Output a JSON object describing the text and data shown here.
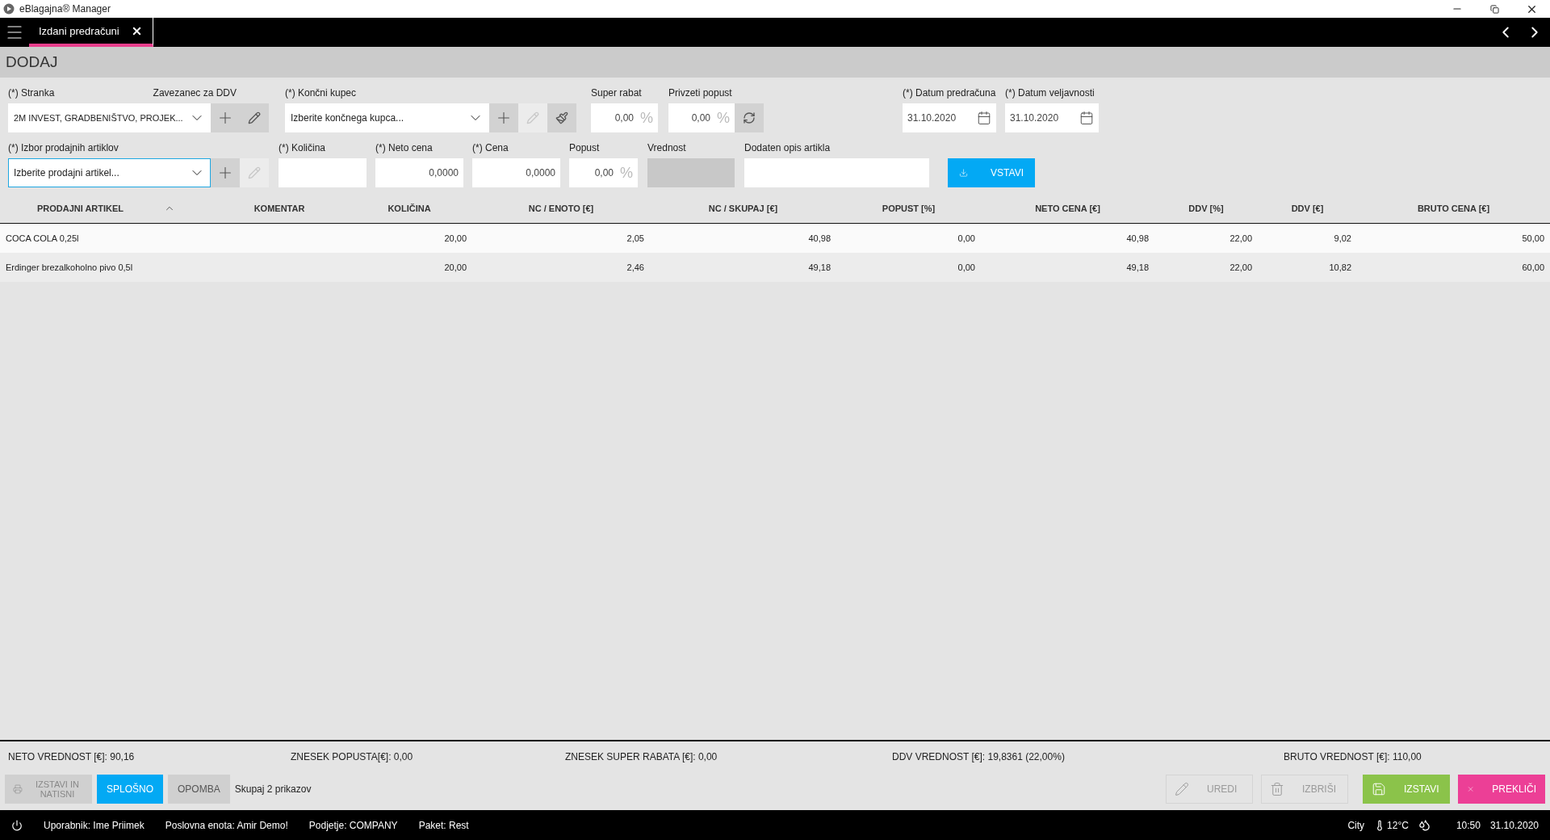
{
  "window": {
    "title": "eBlagajna® Manager"
  },
  "tabs": [
    {
      "label": "Izdani predračuni",
      "selected": true
    }
  ],
  "header": {
    "title": "DODAJ"
  },
  "row1": {
    "stranka": {
      "label": "(*) Stranka",
      "value": "2M INVEST, GRADBENIŠTVO, PROJEK..."
    },
    "zavezanec_label": "Zavezanec za DDV",
    "kupec": {
      "label": "(*) Končni kupec",
      "placeholder": "Izberite končnega kupca..."
    },
    "super_rabat": {
      "label": "Super rabat",
      "value": "0,00",
      "unit": "%"
    },
    "privzeti_popust": {
      "label": "Privzeti popust",
      "value": "0,00",
      "unit": "%"
    },
    "datum_predracuna": {
      "label": "(*) Datum predračuna",
      "value": "31.10.2020"
    },
    "datum_veljavnosti": {
      "label": "(*) Datum veljavnosti",
      "value": "31.10.2020"
    }
  },
  "row2": {
    "artikel": {
      "label": "(*) Izbor prodajnih artiklov",
      "placeholder": "Izberite prodajni artikel..."
    },
    "kolicina": {
      "label": "(*) Količina"
    },
    "neto_cena": {
      "label": "(*) Neto cena",
      "value": "0,0000"
    },
    "cena": {
      "label": "(*) Cena",
      "value": "0,0000"
    },
    "popust": {
      "label": "Popust",
      "value": "0,00",
      "unit": "%"
    },
    "vrednost": {
      "label": "Vrednost"
    },
    "opis": {
      "label": "Dodaten opis artikla"
    },
    "insert_button": "VSTAVI"
  },
  "table": {
    "columns": [
      "PRODAJNI ARTIKEL",
      "KOMENTAR",
      "KOLIČINA",
      "NC / ENOTO [€]",
      "NC / SKUPAJ [€]",
      "POPUST [%]",
      "NETO CENA [€]",
      "DDV [%]",
      "DDV [€]",
      "BRUTO CENA [€]"
    ],
    "rows": [
      {
        "selected": true,
        "cells": [
          "COCA COLA 0,25l",
          "",
          "20,00",
          "2,05",
          "40,98",
          "0,00",
          "40,98",
          "22,00",
          "9,02",
          "50,00"
        ]
      },
      {
        "selected": false,
        "cells": [
          "Erdinger brezalkoholno pivo 0,5l",
          "",
          "20,00",
          "2,46",
          "49,18",
          "0,00",
          "49,18",
          "22,00",
          "10,82",
          "60,00"
        ]
      }
    ]
  },
  "summary": [
    "NETO VREDNOST [€]: 90,16",
    "ZNESEK POPUSTA[€]: 0,00",
    "ZNESEK SUPER RABATA [€]: 0,00",
    "DDV VREDNOST [€]: 19,8361 (22,00%)",
    "BRUTO VREDNOST [€]: 110,00"
  ],
  "print_button": {
    "label": "IZSTAVI IN NATISNI",
    "disabled": true
  },
  "bottom_tabs": [
    {
      "label": "SPLOŠNO",
      "selected": true
    },
    {
      "label": "OPOMBA",
      "selected": false
    }
  ],
  "count": "Skupaj 2 prikazov",
  "actions": [
    {
      "kind": "edit",
      "label": "UREDI",
      "disabled": true
    },
    {
      "kind": "delete",
      "label": "IZBRIŠI",
      "disabled": true
    },
    {
      "kind": "issue",
      "label": "IZSTAVI",
      "disabled": false
    },
    {
      "kind": "cancel",
      "label": "PREKLIČI",
      "disabled": false
    }
  ],
  "status_bar": {
    "items": [
      "Uporabnik: Ime Priimek",
      "Poslovna enota: Amir Demo!",
      "Podjetje: COMPANY",
      "Paket: Rest"
    ],
    "city": "City",
    "temperature": "12°C",
    "time": "10:50",
    "date": "31.10.2020"
  }
}
